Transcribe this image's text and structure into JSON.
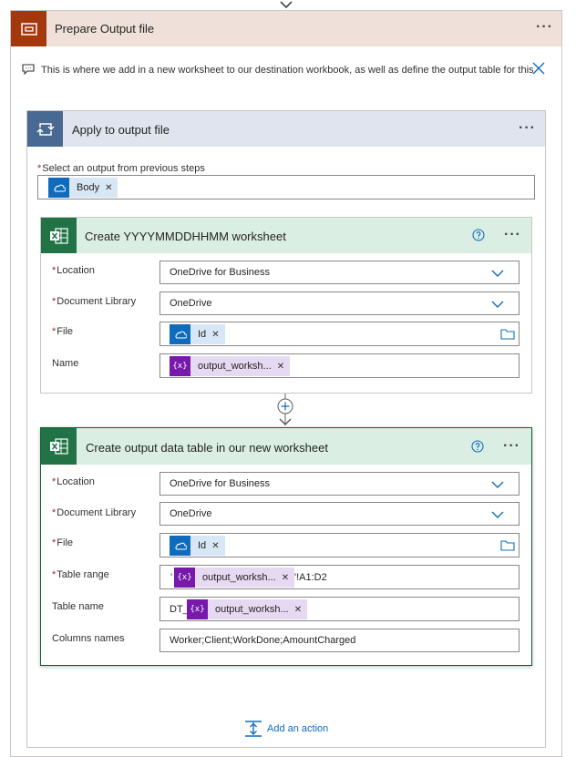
{
  "scope": {
    "title": "Prepare Output file",
    "icon": "scope-icon",
    "color": "#a4380c",
    "header_bg": "#efe1da",
    "note": "This is where we add in a new worksheet to our destination workbook, as well as define the output table for this"
  },
  "apply": {
    "title": "Apply to output file",
    "icon": "loop-icon",
    "color": "#486991",
    "select_label": "Select an output from previous steps",
    "token": "Body"
  },
  "card1": {
    "title": "Create YYYYMMDDHHMM worksheet",
    "fields": {
      "location_label": "Location",
      "location_value": "OneDrive for Business",
      "library_label": "Document Library",
      "library_value": "OneDrive",
      "file_label": "File",
      "file_token": "Id",
      "name_label": "Name",
      "name_token": "output_worksh..."
    }
  },
  "card2": {
    "title": "Create output data table in our new worksheet",
    "fields": {
      "location_label": "Location",
      "location_value": "OneDrive for Business",
      "library_label": "Document Library",
      "library_value": "OneDrive",
      "file_label": "File",
      "file_token": "Id",
      "range_label": "Table range",
      "range_prefix": "'",
      "range_token": "output_worksh...",
      "range_suffix": "'!A1:D2",
      "tname_label": "Table name",
      "tname_prefix": "DT_",
      "tname_token": "output_worksh...",
      "cols_label": "Columns names",
      "cols_value": "Worker;Client;WorkDone;AmountCharged"
    }
  },
  "var_glyph": "{x}",
  "add_action": "Add an action",
  "colors": {
    "excel": "#217346",
    "onedrive": "#0f6cbd",
    "variable": "#7719aa",
    "link": "#0f6cbd",
    "required": "#a4262c"
  }
}
